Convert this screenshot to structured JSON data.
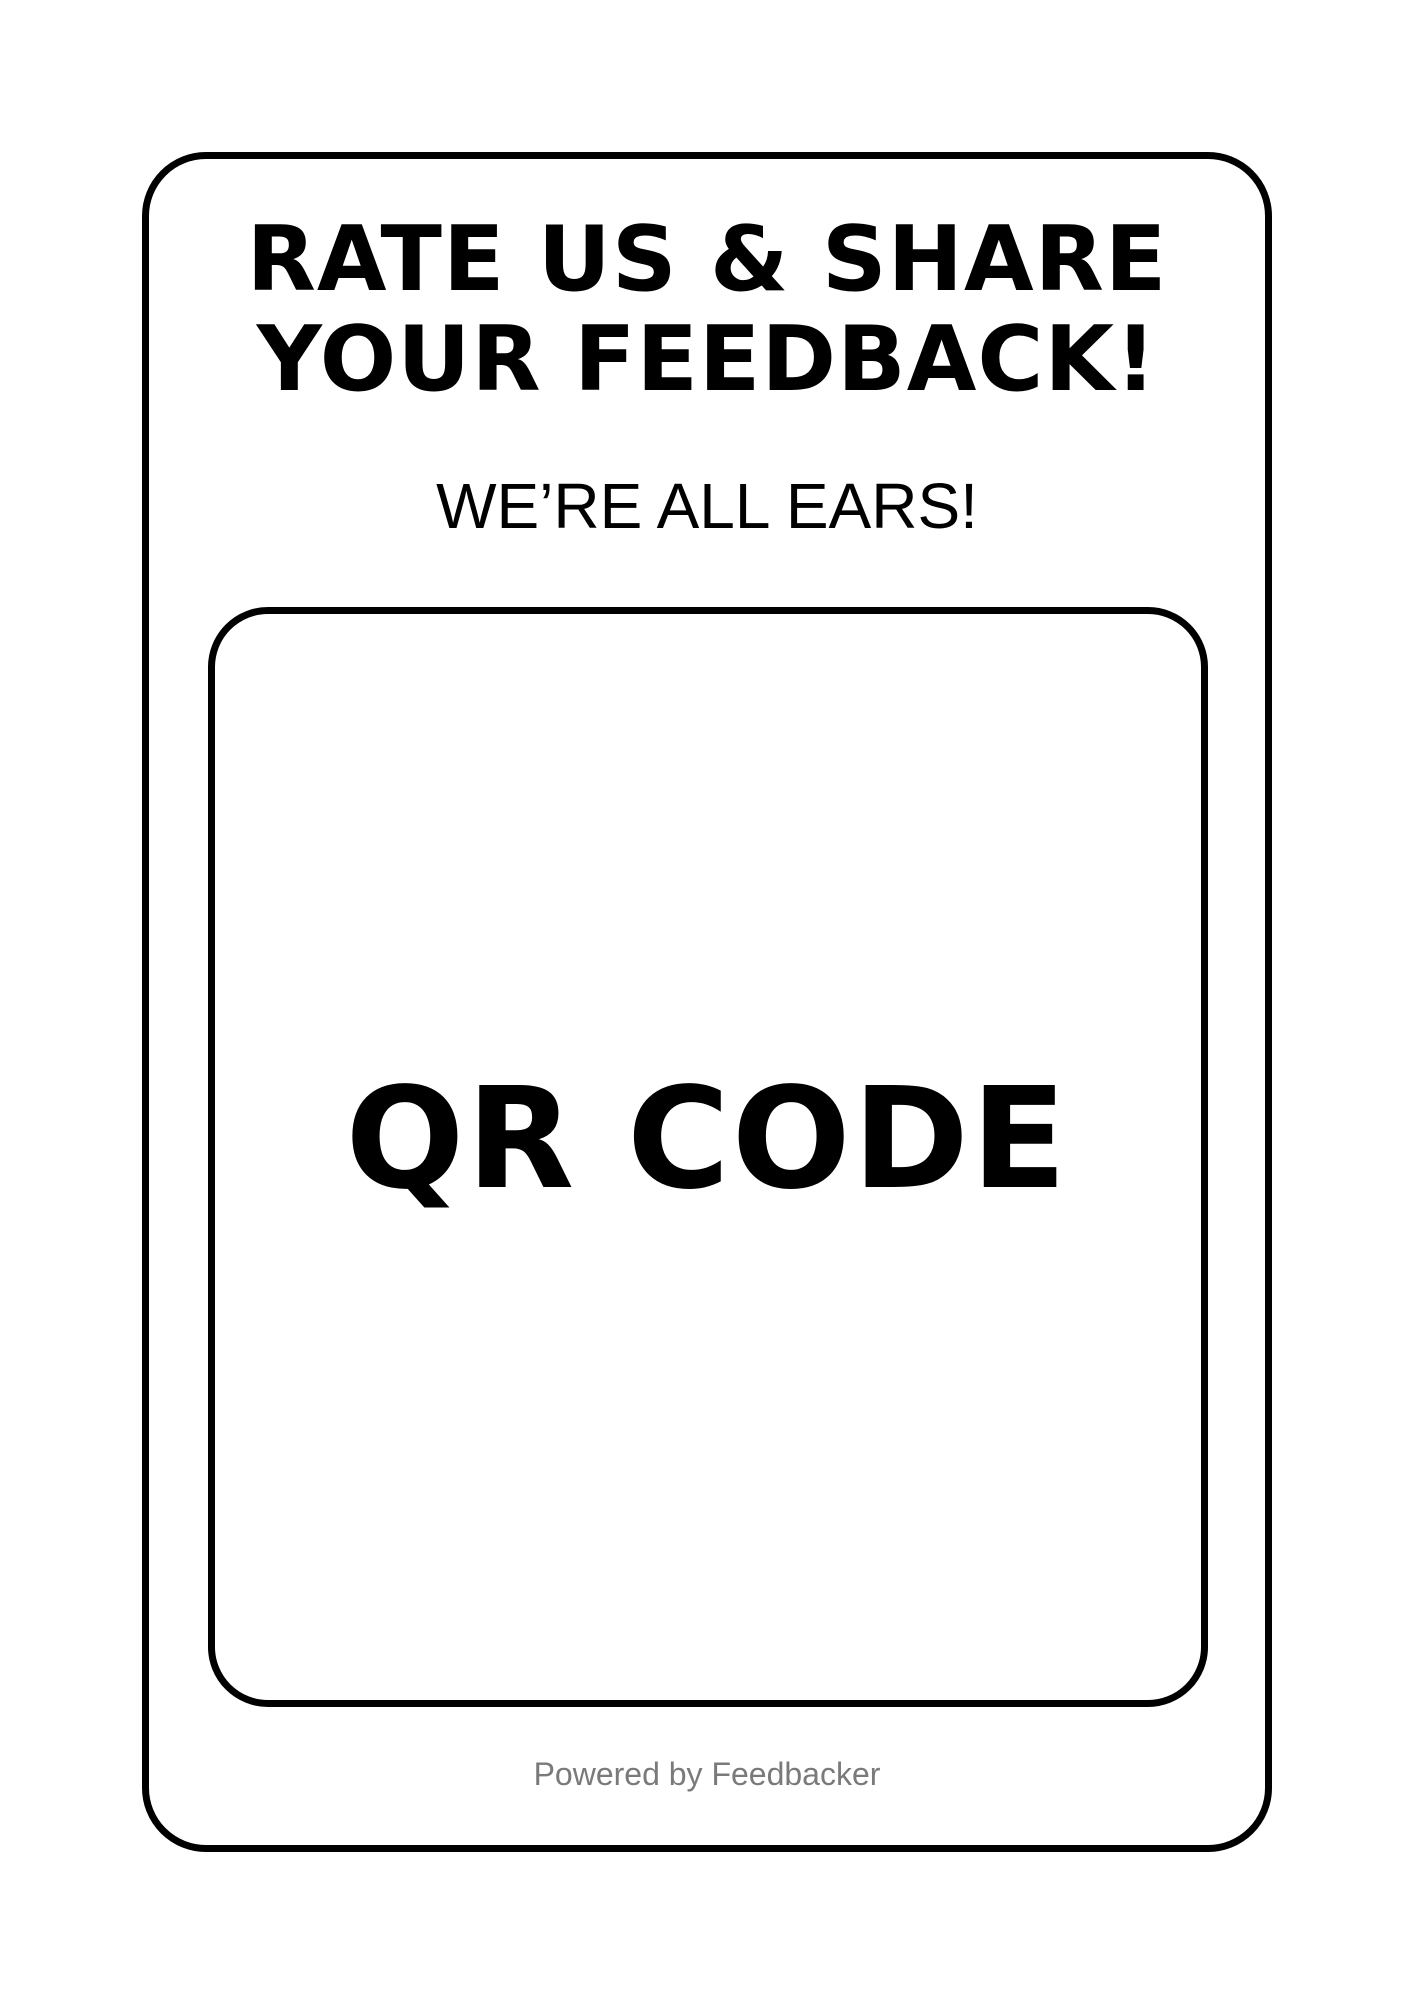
{
  "headline": {
    "line1": "RATE US & SHARE",
    "line2": "YOUR FEEDBACK!"
  },
  "subheadline": "WE’RE ALL EARS!",
  "qr_placeholder": {
    "label": "QR CODE"
  },
  "footer": {
    "powered_by": "Powered by Feedbacker"
  },
  "colors": {
    "ink": "#000000",
    "background": "#ffffff",
    "footer_text": "#7a7a7a"
  }
}
